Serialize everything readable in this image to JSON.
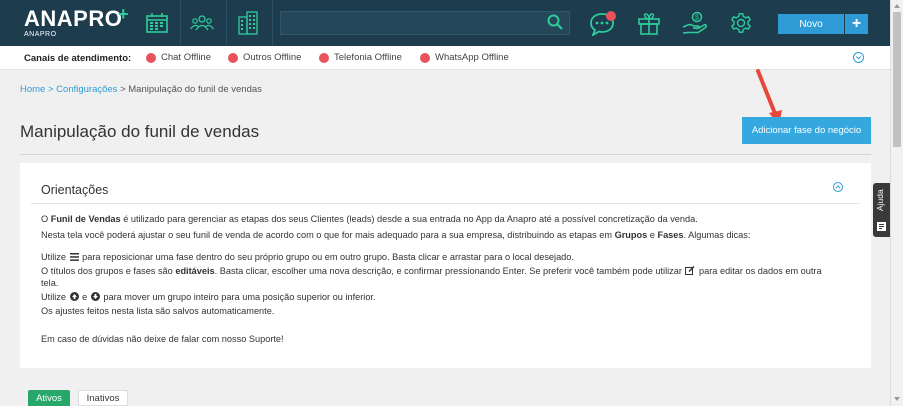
{
  "app": {
    "logo_text": "ANAPRO",
    "logo_plus": "+",
    "logo_subtext": "ANAPRO"
  },
  "header": {
    "search_placeholder": "",
    "novo_label": "Novo",
    "plus_label": "+",
    "icons": [
      "calendar-icon",
      "people-icon",
      "building-icon",
      "search-icon",
      "chat-icon",
      "gift-icon",
      "hand-money-icon",
      "gear-icon"
    ],
    "accent_color": "#2ecc9a",
    "notification_color": "#e9515b"
  },
  "channels": {
    "label": "Canais de atendimento:",
    "items": [
      {
        "label": "Chat Offline"
      },
      {
        "label": "Outros Offline"
      },
      {
        "label": "Telefonia Offline"
      },
      {
        "label": "WhatsApp Offline"
      }
    ],
    "status_color": "#e9515b"
  },
  "breadcrumb": {
    "home": "Home",
    "sep1": " > ",
    "config": "Configurações",
    "sep2": " > ",
    "current": "Manipulação do funil de vendas"
  },
  "page": {
    "title": "Manipulação do funil de vendas",
    "add_phase_label": "Adicionar fase do negócio"
  },
  "orientacoes": {
    "title": "Orientações",
    "p1_a": "O ",
    "p1_b": "Funil de Vendas",
    "p1_c": " é utilizado para gerenciar as etapas dos seus Clientes (leads) desde a sua entrada no App da Anapro até a possível concretização da venda.",
    "p2_a": "Nesta tela você poderá ajustar o seu funil de venda de acordo com o que for mais adequado para a sua empresa, distribuindo as etapas em ",
    "p2_b": "Grupos",
    "p2_c": " e ",
    "p2_d": "Fases",
    "p2_e": ". Algumas dicas:",
    "tip1_a": "Utilize ",
    "tip1_b": " para reposicionar uma fase dentro do seu próprio grupo ou em outro grupo. Basta clicar e arrastar para o local desejado.",
    "tip2_a": "O títulos dos grupos e fases são ",
    "tip2_b": "editáveis",
    "tip2_c": ". Basta clicar, escolher uma nova descrição, e confirmar pressionando Enter. Se preferir você também pode utilizar ",
    "tip2_d": " para editar os dados em outra",
    "tip2_e": "tela.",
    "tip3_a": "Utilize ",
    "tip3_b": " e ",
    "tip3_c": " para mover um grupo inteiro para uma posição superior ou inferior.",
    "tip4": "Os ajustes feitos nesta lista são salvos automaticamente.",
    "footer": "Em caso de dúvidas não deixe de falar com nosso Suporte!"
  },
  "help_tab": {
    "label": "Ajuda"
  },
  "tabs": [
    {
      "label": "Ativos",
      "active": true
    },
    {
      "label": "Inativos",
      "active": false
    }
  ]
}
